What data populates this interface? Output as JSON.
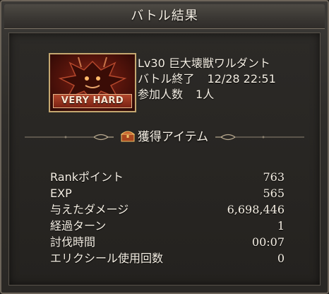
{
  "window": {
    "title": "バトル結果"
  },
  "quest": {
    "difficulty": "VERY HARD",
    "name": "Lv30 巨大壊獣ワルダント",
    "end_label": "バトル終了",
    "end_time": "12/28 22:51",
    "participants_label": "参加人数",
    "participants_value": "1人",
    "accent_color": "#c4a770"
  },
  "section": {
    "title": "獲得アイテム",
    "icon": "treasure-chest-icon"
  },
  "results": [
    {
      "label": "Rankポイント",
      "value": "763"
    },
    {
      "label": "EXP",
      "value": "565"
    },
    {
      "label": "与えたダメージ",
      "value": "6,698,446"
    },
    {
      "label": "経過ターン",
      "value": "1"
    },
    {
      "label": "討伐時間",
      "value": "00:07"
    },
    {
      "label": "エリクシール使用回数",
      "value": "0"
    }
  ]
}
